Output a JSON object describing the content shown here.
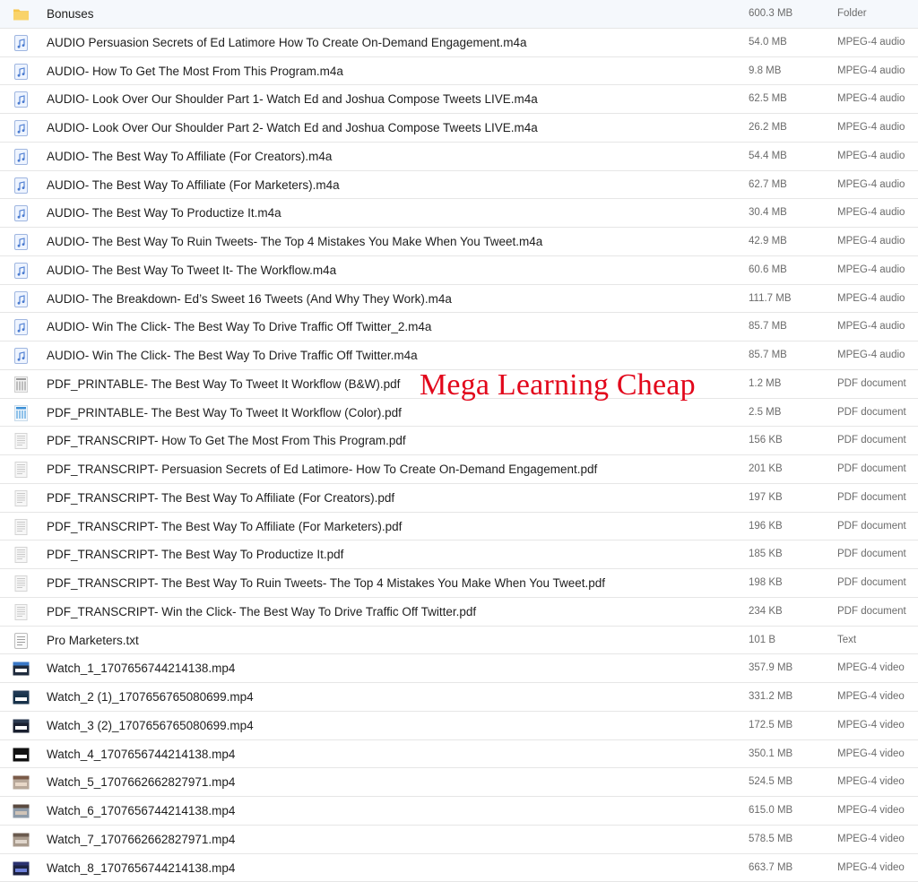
{
  "watermark": "Mega Learning Cheap",
  "files": [
    {
      "name": "Bonuses",
      "size": "600.3 MB",
      "kind": "Folder",
      "icon": "folder-icon"
    },
    {
      "name": "AUDIO Persuasion Secrets of Ed Latimore How To Create On-Demand Engagement.m4a",
      "size": "54.0 MB",
      "kind": "MPEG-4 audio",
      "icon": "audio-file-icon"
    },
    {
      "name": "AUDIO- How To Get The Most From This Program.m4a",
      "size": "9.8 MB",
      "kind": "MPEG-4 audio",
      "icon": "audio-file-icon"
    },
    {
      "name": "AUDIO- Look Over Our Shoulder Part 1- Watch Ed and Joshua Compose Tweets LIVE.m4a",
      "size": "62.5 MB",
      "kind": "MPEG-4 audio",
      "icon": "audio-file-icon"
    },
    {
      "name": "AUDIO- Look Over Our Shoulder Part 2- Watch Ed and Joshua Compose Tweets LIVE.m4a",
      "size": "26.2 MB",
      "kind": "MPEG-4 audio",
      "icon": "audio-file-icon"
    },
    {
      "name": "AUDIO- The Best Way To Affiliate (For Creators).m4a",
      "size": "54.4 MB",
      "kind": "MPEG-4 audio",
      "icon": "audio-file-icon"
    },
    {
      "name": "AUDIO- The Best Way To Affiliate (For Marketers).m4a",
      "size": "62.7 MB",
      "kind": "MPEG-4 audio",
      "icon": "audio-file-icon"
    },
    {
      "name": "AUDIO- The Best Way To Productize It.m4a",
      "size": "30.4 MB",
      "kind": "MPEG-4 audio",
      "icon": "audio-file-icon"
    },
    {
      "name": "AUDIO- The Best Way To Ruin Tweets- The Top 4 Mistakes You Make When You Tweet.m4a",
      "size": "42.9 MB",
      "kind": "MPEG-4 audio",
      "icon": "audio-file-icon"
    },
    {
      "name": "AUDIO- The Best Way To Tweet It- The Workflow.m4a",
      "size": "60.6 MB",
      "kind": "MPEG-4 audio",
      "icon": "audio-file-icon"
    },
    {
      "name": "AUDIO- The Breakdown- Ed’s Sweet 16 Tweets (And Why They Work).m4a",
      "size": "111.7 MB",
      "kind": "MPEG-4 audio",
      "icon": "audio-file-icon"
    },
    {
      "name": "AUDIO- Win The Click- The Best Way To Drive Traffic Off Twitter_2.m4a",
      "size": "85.7 MB",
      "kind": "MPEG-4 audio",
      "icon": "audio-file-icon"
    },
    {
      "name": "AUDIO- Win The Click- The Best Way To Drive Traffic Off Twitter.m4a",
      "size": "85.7 MB",
      "kind": "MPEG-4 audio",
      "icon": "audio-file-icon"
    },
    {
      "name": "PDF_PRINTABLE- The Best Way To Tweet It Workflow (B&W).pdf",
      "size": "1.2 MB",
      "kind": "PDF document",
      "icon": "pdf-bw-thumbnail-icon"
    },
    {
      "name": "PDF_PRINTABLE- The Best Way To Tweet It Workflow (Color).pdf",
      "size": "2.5 MB",
      "kind": "PDF document",
      "icon": "pdf-color-thumbnail-icon"
    },
    {
      "name": "PDF_TRANSCRIPT- How To Get The Most From This Program.pdf",
      "size": "156 KB",
      "kind": "PDF document",
      "icon": "pdf-document-icon"
    },
    {
      "name": "PDF_TRANSCRIPT- Persuasion Secrets of Ed Latimore- How To Create On-Demand Engagement.pdf",
      "size": "201 KB",
      "kind": "PDF document",
      "icon": "pdf-document-icon"
    },
    {
      "name": "PDF_TRANSCRIPT- The Best Way To Affiliate (For Creators).pdf",
      "size": "197 KB",
      "kind": "PDF document",
      "icon": "pdf-document-icon"
    },
    {
      "name": "PDF_TRANSCRIPT- The Best Way To Affiliate (For Marketers).pdf",
      "size": "196 KB",
      "kind": "PDF document",
      "icon": "pdf-document-icon"
    },
    {
      "name": "PDF_TRANSCRIPT- The Best Way To Productize It.pdf",
      "size": "185 KB",
      "kind": "PDF document",
      "icon": "pdf-document-icon"
    },
    {
      "name": "PDF_TRANSCRIPT- The Best Way To Ruin Tweets- The Top 4 Mistakes You Make When You Tweet.pdf",
      "size": "198 KB",
      "kind": "PDF document",
      "icon": "pdf-document-icon"
    },
    {
      "name": "PDF_TRANSCRIPT- Win the Click- The Best Way To Drive Traffic Off Twitter.pdf",
      "size": "234 KB",
      "kind": "PDF document",
      "icon": "pdf-document-icon"
    },
    {
      "name": "Pro Marketers.txt",
      "size": "101 B",
      "kind": "Text",
      "icon": "text-file-icon"
    },
    {
      "name": "Watch_1_1707656744214138.mp4",
      "size": "357.9 MB",
      "kind": "MPEG-4 video",
      "icon": "video-thumbnail-icon"
    },
    {
      "name": "Watch_2 (1)_1707656765080699.mp4",
      "size": "331.2 MB",
      "kind": "MPEG-4 video",
      "icon": "video-thumbnail-icon"
    },
    {
      "name": "Watch_3 (2)_1707656765080699.mp4",
      "size": "172.5 MB",
      "kind": "MPEG-4 video",
      "icon": "video-thumbnail-icon"
    },
    {
      "name": "Watch_4_1707656744214138.mp4",
      "size": "350.1 MB",
      "kind": "MPEG-4 video",
      "icon": "video-thumbnail-icon"
    },
    {
      "name": "Watch_5_1707662662827971.mp4",
      "size": "524.5 MB",
      "kind": "MPEG-4 video",
      "icon": "video-thumbnail-icon"
    },
    {
      "name": "Watch_6_1707656744214138.mp4",
      "size": "615.0 MB",
      "kind": "MPEG-4 video",
      "icon": "video-thumbnail-icon"
    },
    {
      "name": "Watch_7_1707662662827971.mp4",
      "size": "578.5 MB",
      "kind": "MPEG-4 video",
      "icon": "video-thumbnail-icon"
    },
    {
      "name": "Watch_8_1707656744214138.mp4",
      "size": "663.7 MB",
      "kind": "MPEG-4 video",
      "icon": "video-thumbnail-icon"
    }
  ]
}
